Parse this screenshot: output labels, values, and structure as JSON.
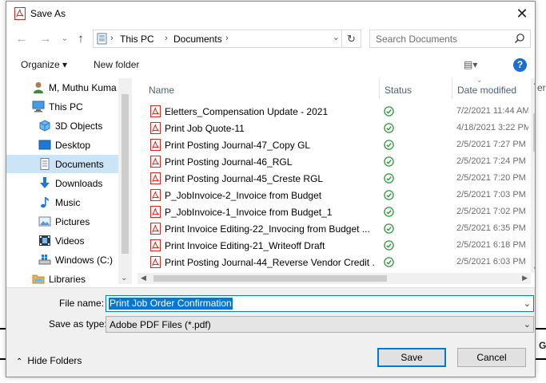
{
  "window": {
    "title": "Save As",
    "close_glyph": "✕"
  },
  "nav": {
    "back_glyph": "←",
    "forward_glyph": "→",
    "up_glyph": "↑",
    "address": [
      "This PC",
      "Documents"
    ],
    "refresh_glyph": "↻",
    "search_placeholder": "Search Documents"
  },
  "toolbar": {
    "organize": "Organize ▾",
    "new_folder": "New folder",
    "view": "▤▾",
    "help": "?"
  },
  "sidebar": {
    "items": [
      {
        "label": "M, Muthu Kuma",
        "icon": "user-icon"
      },
      {
        "label": "This PC",
        "icon": "computer-icon"
      },
      {
        "label": "3D Objects",
        "icon": "cube-icon"
      },
      {
        "label": "Desktop",
        "icon": "desktop-icon"
      },
      {
        "label": "Documents",
        "icon": "document-icon",
        "selected": true
      },
      {
        "label": "Downloads",
        "icon": "download-icon"
      },
      {
        "label": "Music",
        "icon": "music-icon"
      },
      {
        "label": "Pictures",
        "icon": "picture-icon"
      },
      {
        "label": "Videos",
        "icon": "video-icon"
      },
      {
        "label": "Windows (C:)",
        "icon": "drive-icon"
      },
      {
        "label": "Libraries",
        "icon": "folder-icon"
      }
    ]
  },
  "columns": {
    "name": "Name",
    "status": "Status",
    "date": "Date modified"
  },
  "files": [
    {
      "name": "Eletters_Compensation Update - 2021",
      "date": "7/2/2021 11:44 AM"
    },
    {
      "name": "Print Job Quote-11",
      "date": "4/18/2021 3:22 PM"
    },
    {
      "name": "Print Posting Journal-47_Copy GL",
      "date": "2/5/2021 7:27 PM"
    },
    {
      "name": "Print Posting Journal-46_RGL",
      "date": "2/5/2021 7:24 PM"
    },
    {
      "name": "Print Posting Journal-45_Creste RGL",
      "date": "2/5/2021 7:20 PM"
    },
    {
      "name": "P_JobInvoice-2_Invoice from Budget",
      "date": "2/5/2021 7:03 PM"
    },
    {
      "name": "P_JobInvoice-1_Invoice from Budget_1",
      "date": "2/5/2021 7:02 PM"
    },
    {
      "name": "Print Invoice Editing-22_Invocing from Budget ...",
      "date": "2/5/2021 6:35 PM"
    },
    {
      "name": "Print Invoice Editing-21_Writeoff Draft",
      "date": "2/5/2021 6:18 PM"
    },
    {
      "name": "Print Posting Journal-44_Reverse Vendor Credit ...",
      "date": "2/5/2021 6:03 PM"
    }
  ],
  "form": {
    "file_name_label": "File name:",
    "file_name_value": "Print Job Order Confirmation",
    "save_type_label": "Save as type:",
    "save_type_value": "Adobe PDF Files (*.pdf)"
  },
  "footer": {
    "hide_folders": "Hide Folders",
    "save": "Save",
    "cancel": "Cancel"
  },
  "background": {
    "peek_right": "er",
    "peek_g": "G"
  },
  "colors": {
    "accent": "#0078d7",
    "selection": "#cce4f7",
    "pdf_red": "#d9251d",
    "status_green": "#2e9a3a"
  }
}
